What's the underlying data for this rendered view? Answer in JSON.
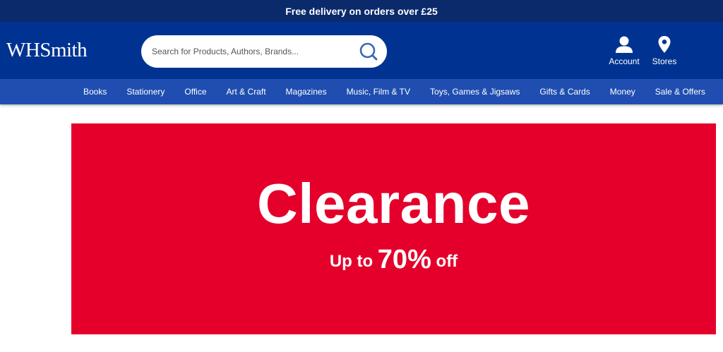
{
  "promo": {
    "text": "Free delivery on orders over £25"
  },
  "header": {
    "logo": "WHSmith",
    "search_placeholder": "Search for Products, Authors, Brands...",
    "account_label": "Account",
    "stores_label": "Stores"
  },
  "nav": {
    "items": [
      "Books",
      "Stationery",
      "Office",
      "Art & Craft",
      "Magazines",
      "Music, Film & TV",
      "Toys, Games & Jigsaws",
      "Gifts & Cards",
      "Money",
      "Sale & Offers"
    ]
  },
  "hero": {
    "title": "Clearance",
    "sub_prefix": "Up to",
    "sub_value": "70%",
    "sub_suffix": "off"
  },
  "colors": {
    "promo_bg": "#0a2a6b",
    "header_bg": "#003391",
    "nav_bg": "#1f4eb0",
    "hero_bg": "#e4002b",
    "search_icon": "#3a69b8"
  },
  "icons": [
    "search-icon",
    "account-icon",
    "location-pin-icon"
  ]
}
